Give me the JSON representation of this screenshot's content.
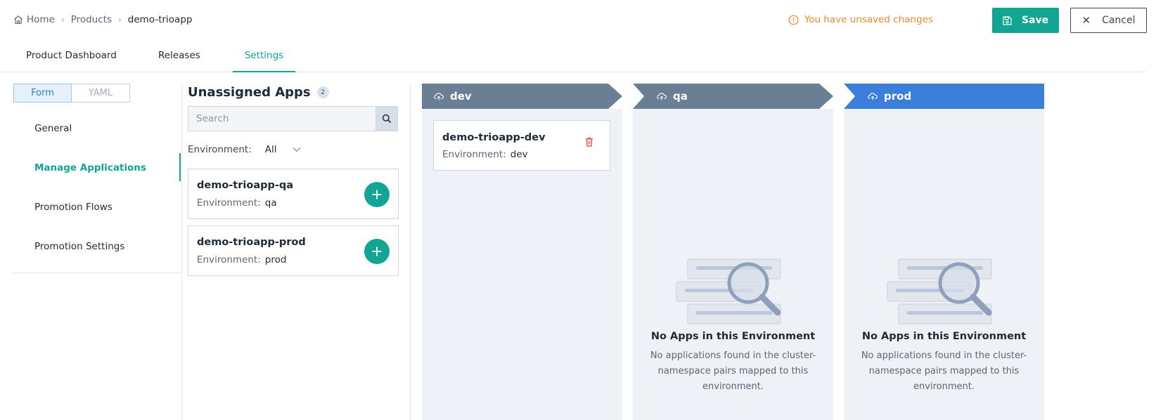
{
  "breadcrumb": {
    "home": "Home",
    "products": "Products",
    "current": "demo-trioapp"
  },
  "header": {
    "unsaved": "You have unsaved changes",
    "save_label": "Save",
    "cancel_label": "Cancel"
  },
  "tabs": [
    {
      "label": "Product Dashboard"
    },
    {
      "label": "Releases"
    },
    {
      "label": "Settings",
      "active": true
    }
  ],
  "mode": {
    "form": "Form",
    "yaml": "YAML",
    "selected": "Form"
  },
  "sidebar": {
    "items": [
      {
        "label": "General"
      },
      {
        "label": "Manage Applications",
        "active": true
      },
      {
        "label": "Promotion Flows"
      },
      {
        "label": "Promotion Settings"
      }
    ]
  },
  "unassigned": {
    "title": "Unassigned Apps",
    "count": "2",
    "search_placeholder": "Search",
    "env_filter_label": "Environment:",
    "env_filter_value": "All",
    "apps": [
      {
        "name": "demo-trioapp-qa",
        "env_label": "Environment:",
        "env": "qa"
      },
      {
        "name": "demo-trioapp-prod",
        "env_label": "Environment:",
        "env": "prod"
      }
    ]
  },
  "environments": [
    {
      "name": "dev",
      "color": "#6a7f93",
      "apps": [
        {
          "name": "demo-trioapp-dev",
          "env_label": "Environment:",
          "env": "dev"
        }
      ]
    },
    {
      "name": "qa",
      "color": "#6a7f93",
      "empty_title": "No Apps in this Environment",
      "empty_desc": "No applications found in the cluster-namespace pairs mapped to this environment."
    },
    {
      "name": "prod",
      "color": "#3c7fdb",
      "empty_title": "No Apps in this Environment",
      "empty_desc": "No applications found in the cluster-namespace pairs mapped to this environment."
    }
  ],
  "colors": {
    "accent": "#12a593",
    "warning": "#f0892a",
    "danger": "#e0453a"
  }
}
